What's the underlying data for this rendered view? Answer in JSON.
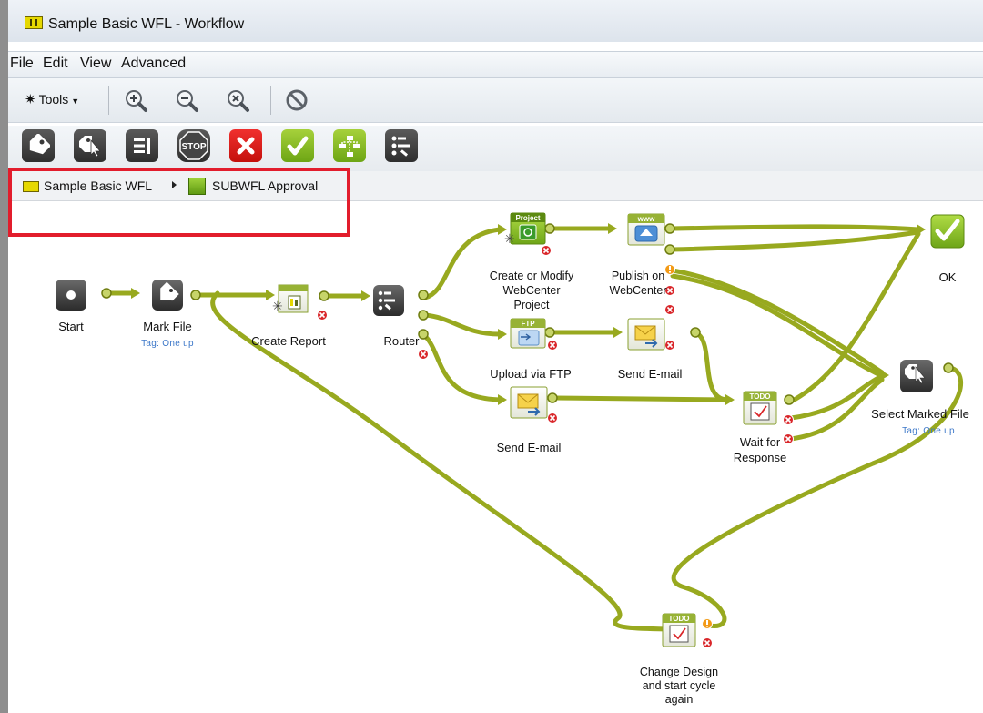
{
  "window": {
    "title": "Sample Basic WFL - Workflow"
  },
  "menu": {
    "items": [
      "File",
      "Edit",
      "View",
      "Advanced"
    ]
  },
  "toolbar": {
    "tools_label": "Tools"
  },
  "breadcrumb": {
    "root": "Sample Basic WFL",
    "current": "SUBWFL Approval"
  },
  "nodes": {
    "start": "Start",
    "mark_file": "Mark File",
    "mark_file_tag": "Tag: One up",
    "create_report": "Create Report",
    "router": "Router",
    "create_project_1": "Create or Modify",
    "create_project_2": "WebCenter",
    "create_project_3": "Project",
    "publish_1": "Publish on",
    "publish_2": "WebCenter",
    "ok": "OK",
    "upload_ftp": "Upload via FTP",
    "send_email_top": "Send E-mail",
    "send_email_bottom": "Send E-mail",
    "wait_1": "Wait for",
    "wait_2": "Response",
    "select_marked": "Select Marked File",
    "select_marked_tag": "Tag: One up",
    "change_1": "Change Design",
    "change_2": "and start cycle",
    "change_3": "again"
  },
  "badges": {
    "project": "Project",
    "www": "www",
    "ftp": "FTP",
    "todo": "TODO",
    "stop": "STOP"
  },
  "colors": {
    "connector": "#98a91f",
    "connector_dark": "#6f7d10",
    "highlight": "#e21d2c",
    "tag_text": "#3d78c9",
    "error": "#d9262a",
    "warning": "#f39a16"
  }
}
